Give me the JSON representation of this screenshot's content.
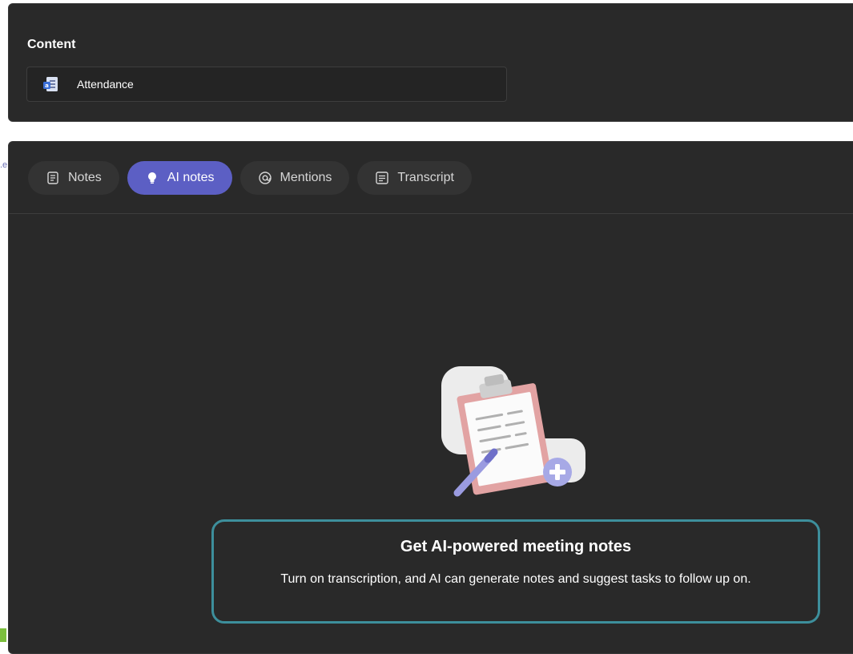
{
  "content_section": {
    "title": "Content",
    "item": {
      "label": "Attendance",
      "icon": "attendance-file-icon"
    }
  },
  "tabs": [
    {
      "label": "Notes",
      "icon": "notes-icon",
      "active": false
    },
    {
      "label": "AI notes",
      "icon": "lightbulb-icon",
      "active": true
    },
    {
      "label": "Mentions",
      "icon": "at-icon",
      "active": false
    },
    {
      "label": "Transcript",
      "icon": "transcript-icon",
      "active": false
    }
  ],
  "empty_state": {
    "title": "Get AI-powered meeting notes",
    "body": "Turn on transcription, and AI can generate notes and suggest tasks to follow up on."
  },
  "colors": {
    "accent": "#5c5fc4",
    "highlight_border": "#3d8f9c",
    "panel_bg": "#292929"
  }
}
